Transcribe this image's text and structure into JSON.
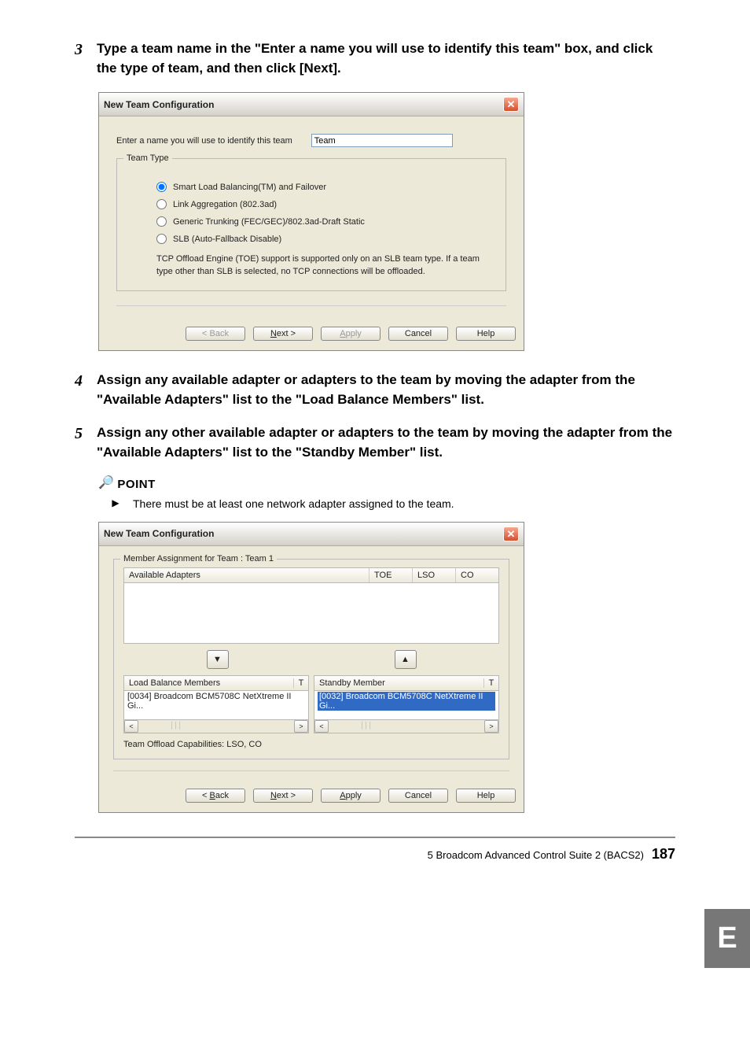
{
  "steps": {
    "s3_num": "3",
    "s3_text": "Type a team name in the \"Enter a name you will use to identify this team\" box, and click the type of team, and then click [Next].",
    "s4_num": "4",
    "s4_text": "Assign any available adapter or adapters to the team by moving the adapter from the \"Available Adapters\" list to the \"Load Balance Members\" list.",
    "s5_num": "5",
    "s5_text": "Assign any other available adapter or adapters to the team by moving the adapter from the \"Available Adapters\" list to the \"Standby Member\" list."
  },
  "dialog1": {
    "title": "New Team Configuration",
    "name_label": "Enter a name you will use to identify this team",
    "name_value": "Team",
    "fieldset_legend": "Team Type",
    "opt1": "Smart Load Balancing(TM) and Failover",
    "opt2": "Link Aggregation (802.3ad)",
    "opt3": "Generic Trunking (FEC/GEC)/802.3ad-Draft Static",
    "opt4": "SLB (Auto-Fallback Disable)",
    "hint": "TCP Offload Engine (TOE) support is supported only on an SLB team type.  If a team type other than SLB is selected, no TCP connections will be offloaded."
  },
  "buttons": {
    "back": "< Back",
    "next_pre": "N",
    "next_post": "ext >",
    "apply_pre": "A",
    "apply_post": "pply",
    "cancel": "Cancel",
    "help": "Help"
  },
  "point": {
    "label": "POINT",
    "text": "There must be at least one network adapter assigned to the team."
  },
  "dialog2": {
    "title": "New Team Configuration",
    "fieldset_legend": "Member Assignment for Team : Team 1",
    "avail_header": "Available Adapters",
    "col_toe": "TOE",
    "col_lso": "LSO",
    "col_co": "CO",
    "lb_header": "Load Balance Members",
    "sb_header": "Standby Member",
    "col_t": "T",
    "lb_item": "[0034] Broadcom BCM5708C NetXtreme II Gi...",
    "sb_item": "[0032] Broadcom BCM5708C NetXtreme II Gi...",
    "caps": "Team Offload Capabilities:  LSO, CO"
  },
  "footer": {
    "section": "5  Broadcom Advanced Control Suite 2 (BACS2)",
    "page": "187"
  },
  "sidetab": "E"
}
